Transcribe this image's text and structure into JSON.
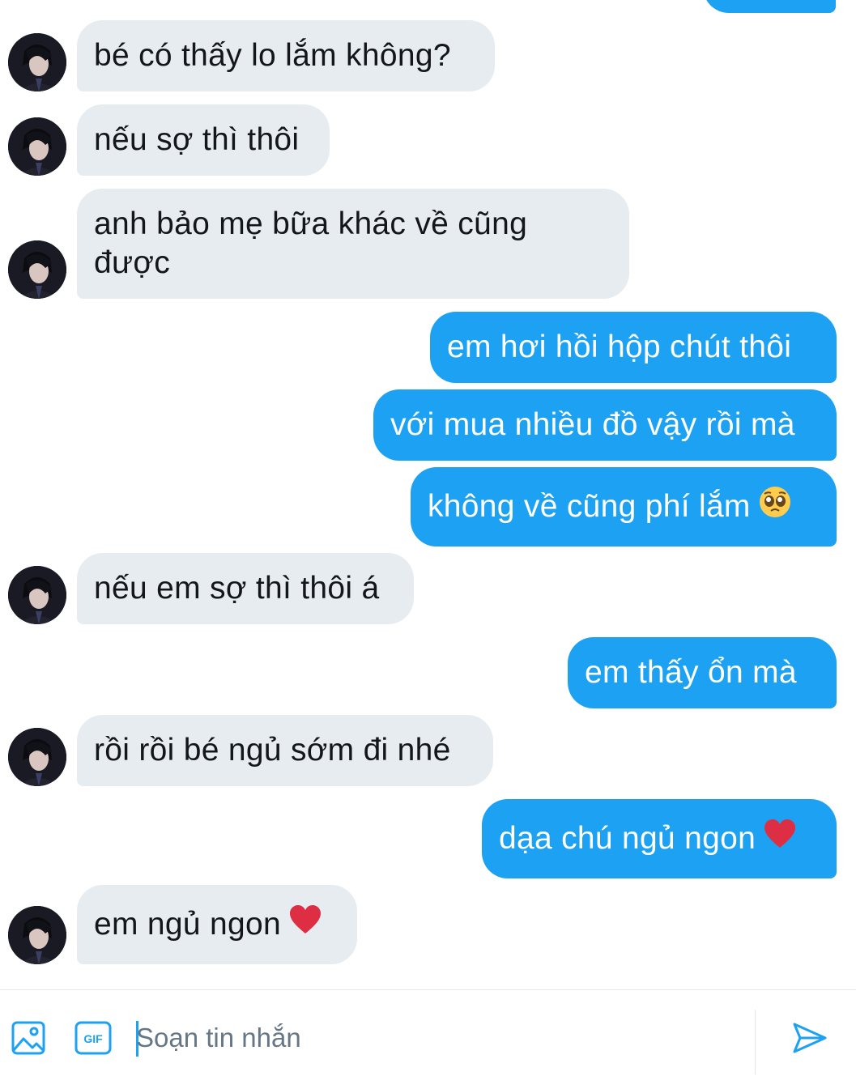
{
  "conversation": {
    "messages": [
      {
        "side": "out",
        "text": ""
      },
      {
        "side": "in",
        "text": "bé có thấy lo lắm không?"
      },
      {
        "side": "in",
        "text": "nếu sợ thì thôi"
      },
      {
        "side": "in",
        "text": "anh bảo mẹ bữa khác về cũng được"
      },
      {
        "side": "out",
        "text": "em hơi hồi hộp chút thôi"
      },
      {
        "side": "out",
        "text": "với mua nhiều đồ vậy rồi mà"
      },
      {
        "side": "out",
        "text": "không về cũng phí lắm",
        "emoji": "pleading-face"
      },
      {
        "side": "in",
        "text": "nếu em sợ thì thôi á"
      },
      {
        "side": "out",
        "text": "em thấy ổn mà"
      },
      {
        "side": "in",
        "text": "rồi rồi bé ngủ sớm đi nhé"
      },
      {
        "side": "out",
        "text": "dạa chú ngủ ngon",
        "emoji": "red-heart"
      },
      {
        "side": "in",
        "text": "em ngủ ngon",
        "emoji": "red-heart"
      }
    ]
  },
  "composer": {
    "placeholder": "Soạn tin nhắn",
    "gif_label": "GIF",
    "icons": [
      "image-icon",
      "gif-icon",
      "send-icon"
    ]
  },
  "colors": {
    "outgoing_bubble": "#1da1f2",
    "incoming_bubble": "#e6ecf0",
    "accent": "#1da1f2"
  }
}
